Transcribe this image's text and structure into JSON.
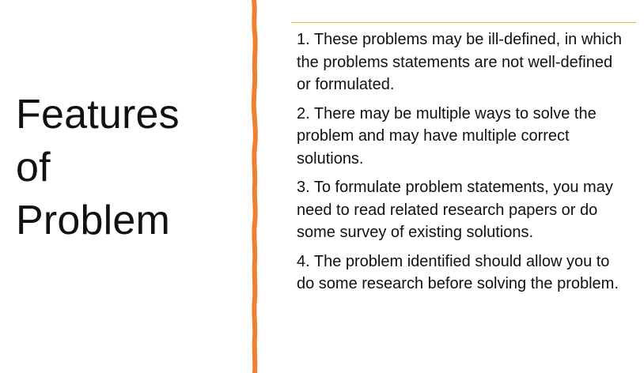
{
  "slide": {
    "title_lines": [
      "Features",
      "of",
      "Problem"
    ],
    "points": [
      "1. These problems may be ill-defined, in which the problems statements are not well-defined or formulated.",
      "2. There may be multiple ways to solve the problem and may have multiple correct solutions.",
      "3. To formulate problem statements, you may need to read related research papers or do some survey of existing solutions.",
      "4. The problem identified should allow you to do some research before solving the problem."
    ]
  },
  "colors": {
    "divider": "#f07f2f",
    "top_rule": "#f2b03b",
    "text": "#111111"
  }
}
